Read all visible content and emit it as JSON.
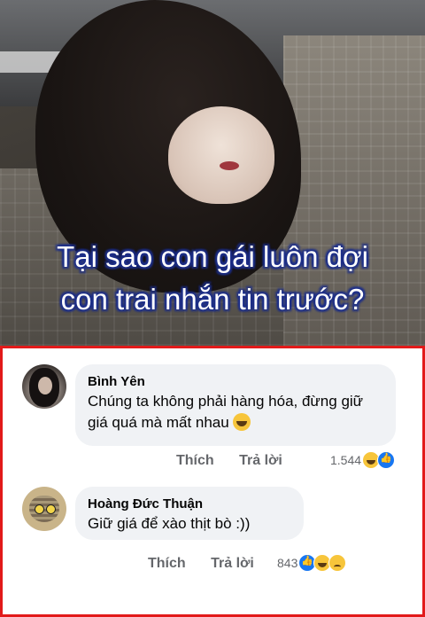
{
  "post": {
    "headline_line1": "Tại sao con gái luôn đợi",
    "headline_line2": "con trai nhắn tin trước?"
  },
  "comments": [
    {
      "author": "Bình Yên",
      "text": "Chúng ta không phải hàng hóa, đừng giữ giá quá mà mất nhau",
      "like_label": "Thích",
      "reply_label": "Trả lời",
      "reaction_count": "1.544",
      "reactions": [
        "haha",
        "like"
      ]
    },
    {
      "author": "Hoàng Đức Thuận",
      "text": "Giữ giá để xào thịt bò :))",
      "like_label": "Thích",
      "reply_label": "Trả lời",
      "reaction_count": "843",
      "reactions": [
        "like",
        "haha",
        "sad"
      ]
    }
  ],
  "colors": {
    "panel_border": "#e21a1a",
    "bubble": "#f0f2f5",
    "action_text": "#65676b",
    "headline_outline": "#1d2f8a"
  }
}
